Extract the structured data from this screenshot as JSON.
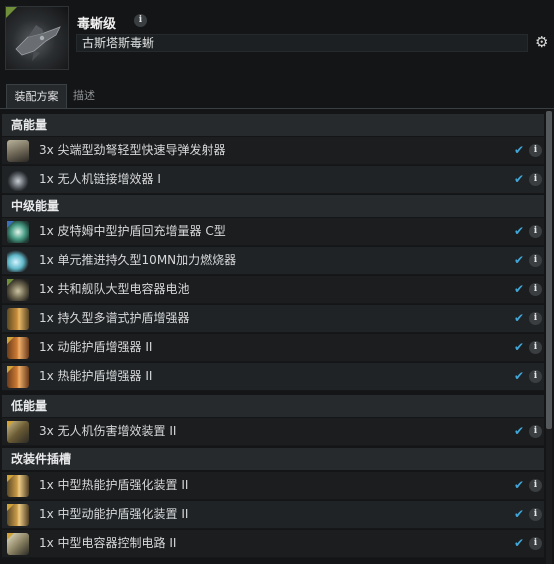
{
  "header": {
    "title": "毒蜥级",
    "name_value": "古斯塔斯毒蜥",
    "info_icon": "info-icon",
    "settings_icon": "gear-icon"
  },
  "tabs": [
    {
      "label": "装配方案",
      "active": true
    },
    {
      "label": "描述",
      "active": false
    }
  ],
  "sections": {
    "high": {
      "label": "高能量",
      "rows": [
        {
          "label": "3x 尖端型劲弩轻型快速导弹发射器"
        },
        {
          "label": "1x 无人机链接增效器 I"
        }
      ]
    },
    "mid": {
      "label": "中级能量",
      "rows": [
        {
          "label": "1x 皮特姆中型护盾回充增量器 C型"
        },
        {
          "label": "1x 单元推进持久型10MN加力燃烧器"
        },
        {
          "label": "1x 共和舰队大型电容器电池"
        },
        {
          "label": "1x 持久型多谱式护盾增强器"
        },
        {
          "label": "1x 动能护盾增强器 II"
        },
        {
          "label": "1x 热能护盾增强器 II"
        }
      ]
    },
    "low": {
      "label": "低能量",
      "rows": [
        {
          "label": "3x 无人机伤害增效装置 II"
        }
      ]
    },
    "rig": {
      "label": "改装件插槽",
      "rows": [
        {
          "label": "1x 中型热能护盾强化装置 II"
        },
        {
          "label": "1x 中型动能护盾强化装置 II"
        },
        {
          "label": "1x 中型电容器控制电路 II"
        }
      ]
    }
  },
  "row_status": "✔",
  "colors": {
    "check": "#41a7d8",
    "section_bg": "#272a2d",
    "row_bg": "#1b1d1f"
  }
}
